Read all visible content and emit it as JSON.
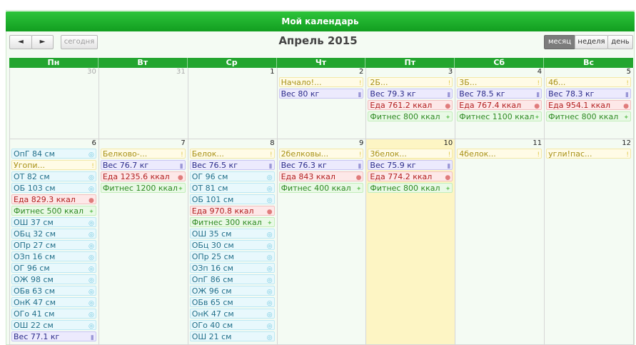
{
  "calendar": {
    "title": "Мой календарь",
    "month_title": "Апрель 2015",
    "nav": {
      "prev": "◄",
      "next": "►",
      "today": "сегодня"
    },
    "views": [
      "месяц",
      "неделя",
      "день"
    ],
    "active_view": "месяц",
    "weekdays": [
      "Пн",
      "Вт",
      "Ср",
      "Чт",
      "Пт",
      "Сб",
      "Вс"
    ]
  },
  "weeks": [
    {
      "days": [
        {
          "num": "30",
          "other": true,
          "events": []
        },
        {
          "num": "31",
          "other": true,
          "events": []
        },
        {
          "num": "1",
          "events": []
        },
        {
          "num": "2",
          "events": [
            {
              "type": "note",
              "text": "Начало!..."
            },
            {
              "type": "weight",
              "text": "Вес 80 кг"
            }
          ]
        },
        {
          "num": "3",
          "events": [
            {
              "type": "note",
              "text": "2Б..."
            },
            {
              "type": "weight",
              "text": "Вес 79.3 кг"
            },
            {
              "type": "food",
              "text": "Еда 761.2 ккал"
            },
            {
              "type": "fit",
              "text": "Фитнес 800 ккал"
            }
          ]
        },
        {
          "num": "4",
          "events": [
            {
              "type": "note",
              "text": "3Б..."
            },
            {
              "type": "weight",
              "text": "Вес 78.5 кг"
            },
            {
              "type": "food",
              "text": "Еда 767.4 ккал"
            },
            {
              "type": "fit",
              "text": "Фитнес 1100 ккал"
            }
          ]
        },
        {
          "num": "5",
          "events": [
            {
              "type": "note",
              "text": "4б..."
            },
            {
              "type": "weight",
              "text": "Вес 78.3 кг"
            },
            {
              "type": "food",
              "text": "Еда 954.1 ккал"
            },
            {
              "type": "fit",
              "text": "Фитнес 800 ккал"
            }
          ]
        }
      ]
    },
    {
      "days": [
        {
          "num": "6",
          "events": [
            {
              "type": "meas",
              "text": "ОпГ 84 см"
            },
            {
              "type": "note",
              "text": "Угопи..."
            },
            {
              "type": "meas",
              "text": "ОТ 82 см"
            },
            {
              "type": "meas",
              "text": "ОБ 103 см"
            },
            {
              "type": "food",
              "text": "Еда 829.3 ккал"
            },
            {
              "type": "fit",
              "text": "Фитнес 500 ккал"
            },
            {
              "type": "meas",
              "text": "ОШ 37 см"
            },
            {
              "type": "meas",
              "text": "ОБц 32 см"
            },
            {
              "type": "meas",
              "text": "ОПр 27 см"
            },
            {
              "type": "meas",
              "text": "ОЗп 16 см"
            },
            {
              "type": "meas",
              "text": "ОГ 96 см"
            },
            {
              "type": "meas",
              "text": "ОЖ 98 см"
            },
            {
              "type": "meas",
              "text": "ОБв 63 см"
            },
            {
              "type": "meas",
              "text": "ОнК 47 см"
            },
            {
              "type": "meas",
              "text": "ОГо 41 см"
            },
            {
              "type": "meas",
              "text": "ОШ 22 см"
            },
            {
              "type": "weight",
              "text": "Вес 77.1 кг"
            }
          ]
        },
        {
          "num": "7",
          "events": [
            {
              "type": "note",
              "text": "Белково-..."
            },
            {
              "type": "weight",
              "text": "Вес 76.7 кг"
            },
            {
              "type": "food",
              "text": "Еда 1235.6 ккал"
            },
            {
              "type": "fit",
              "text": "Фитнес 1200 ккал"
            }
          ]
        },
        {
          "num": "8",
          "events": [
            {
              "type": "note",
              "text": "Белок..."
            },
            {
              "type": "weight",
              "text": "Вес 76.5 кг"
            },
            {
              "type": "meas",
              "text": "ОГ 96 см"
            },
            {
              "type": "meas",
              "text": "ОТ 81 см"
            },
            {
              "type": "meas",
              "text": "ОБ 101 см"
            },
            {
              "type": "food",
              "text": "Еда 970.8 ккал"
            },
            {
              "type": "fit",
              "text": "Фитнес 300 ккал"
            },
            {
              "type": "meas",
              "text": "ОШ 35 см"
            },
            {
              "type": "meas",
              "text": "ОБц 30 см"
            },
            {
              "type": "meas",
              "text": "ОПр 25 см"
            },
            {
              "type": "meas",
              "text": "ОЗп 16 см"
            },
            {
              "type": "meas",
              "text": "ОпГ 86 см"
            },
            {
              "type": "meas",
              "text": "ОЖ 96 см"
            },
            {
              "type": "meas",
              "text": "ОБв 65 см"
            },
            {
              "type": "meas",
              "text": "ОнК 47 см"
            },
            {
              "type": "meas",
              "text": "ОГо 40 см"
            },
            {
              "type": "meas",
              "text": "ОШ 21 см"
            }
          ]
        },
        {
          "num": "9",
          "events": [
            {
              "type": "note",
              "text": "2белковы..."
            },
            {
              "type": "weight",
              "text": "Вес 76.3 кг"
            },
            {
              "type": "food",
              "text": "Еда 843 ккал"
            },
            {
              "type": "fit",
              "text": "Фитнес 400 ккал"
            }
          ]
        },
        {
          "num": "10",
          "today": true,
          "events": [
            {
              "type": "note",
              "text": "3белок..."
            },
            {
              "type": "weight",
              "text": "Вес 75.9 кг"
            },
            {
              "type": "food",
              "text": "Еда 774.2 ккал"
            },
            {
              "type": "fit",
              "text": "Фитнес 800 ккал"
            }
          ]
        },
        {
          "num": "11",
          "events": [
            {
              "type": "note",
              "text": "4белок..."
            }
          ]
        },
        {
          "num": "12",
          "events": [
            {
              "type": "note",
              "text": "угли!пас..."
            }
          ]
        }
      ]
    }
  ],
  "icons": {
    "note": "!",
    "weight": "▮",
    "food": "●",
    "fit": "✦",
    "meas": "◎"
  },
  "icon_names": {
    "note": "exclamation-icon",
    "weight": "scale-icon",
    "food": "apple-icon",
    "fit": "dumbbell-icon",
    "meas": "tape-measure-icon"
  }
}
